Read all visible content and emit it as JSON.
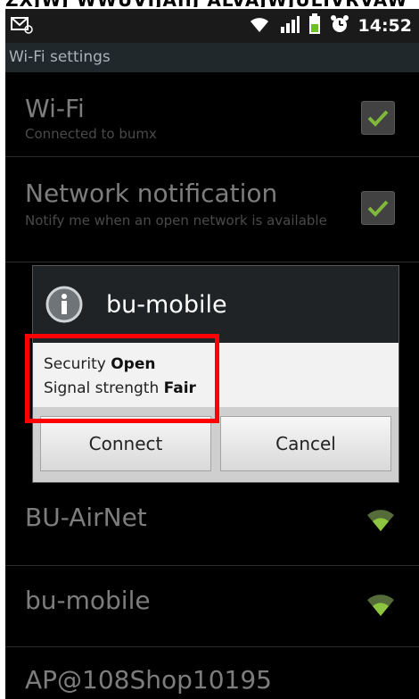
{
  "caption": "ZXJWJ WWUVIJAIIJ ALVAJWJULIVRVAW",
  "status_bar": {
    "time": "14:52",
    "icons": [
      "notification-envelope-icon",
      "wifi-signal-icon",
      "cell-signal-icon",
      "battery-icon",
      "alarm-icon"
    ]
  },
  "section_header": "Wi-Fi settings",
  "settings": {
    "wifi": {
      "title": "Wi-Fi",
      "summary": "Connected to bumx",
      "checked": true
    },
    "network_notification": {
      "title": "Network notification",
      "summary": "Notify me when an open network is available",
      "checked": true
    }
  },
  "networks": [
    {
      "name": "BU-AirNet",
      "icon": "wifi-signal-icon"
    },
    {
      "name": "bu-mobile",
      "icon": "wifi-signal-icon"
    },
    {
      "name": "AP@108Shop10195"
    }
  ],
  "dialog": {
    "title": "bu-mobile",
    "security_label": "Security",
    "security_value": "Open",
    "signal_label": "Signal strength",
    "signal_value": "Fair",
    "connect_label": "Connect",
    "cancel_label": "Cancel"
  },
  "colors": {
    "highlight": "#ff0000",
    "check_green": "#8cc63f"
  }
}
